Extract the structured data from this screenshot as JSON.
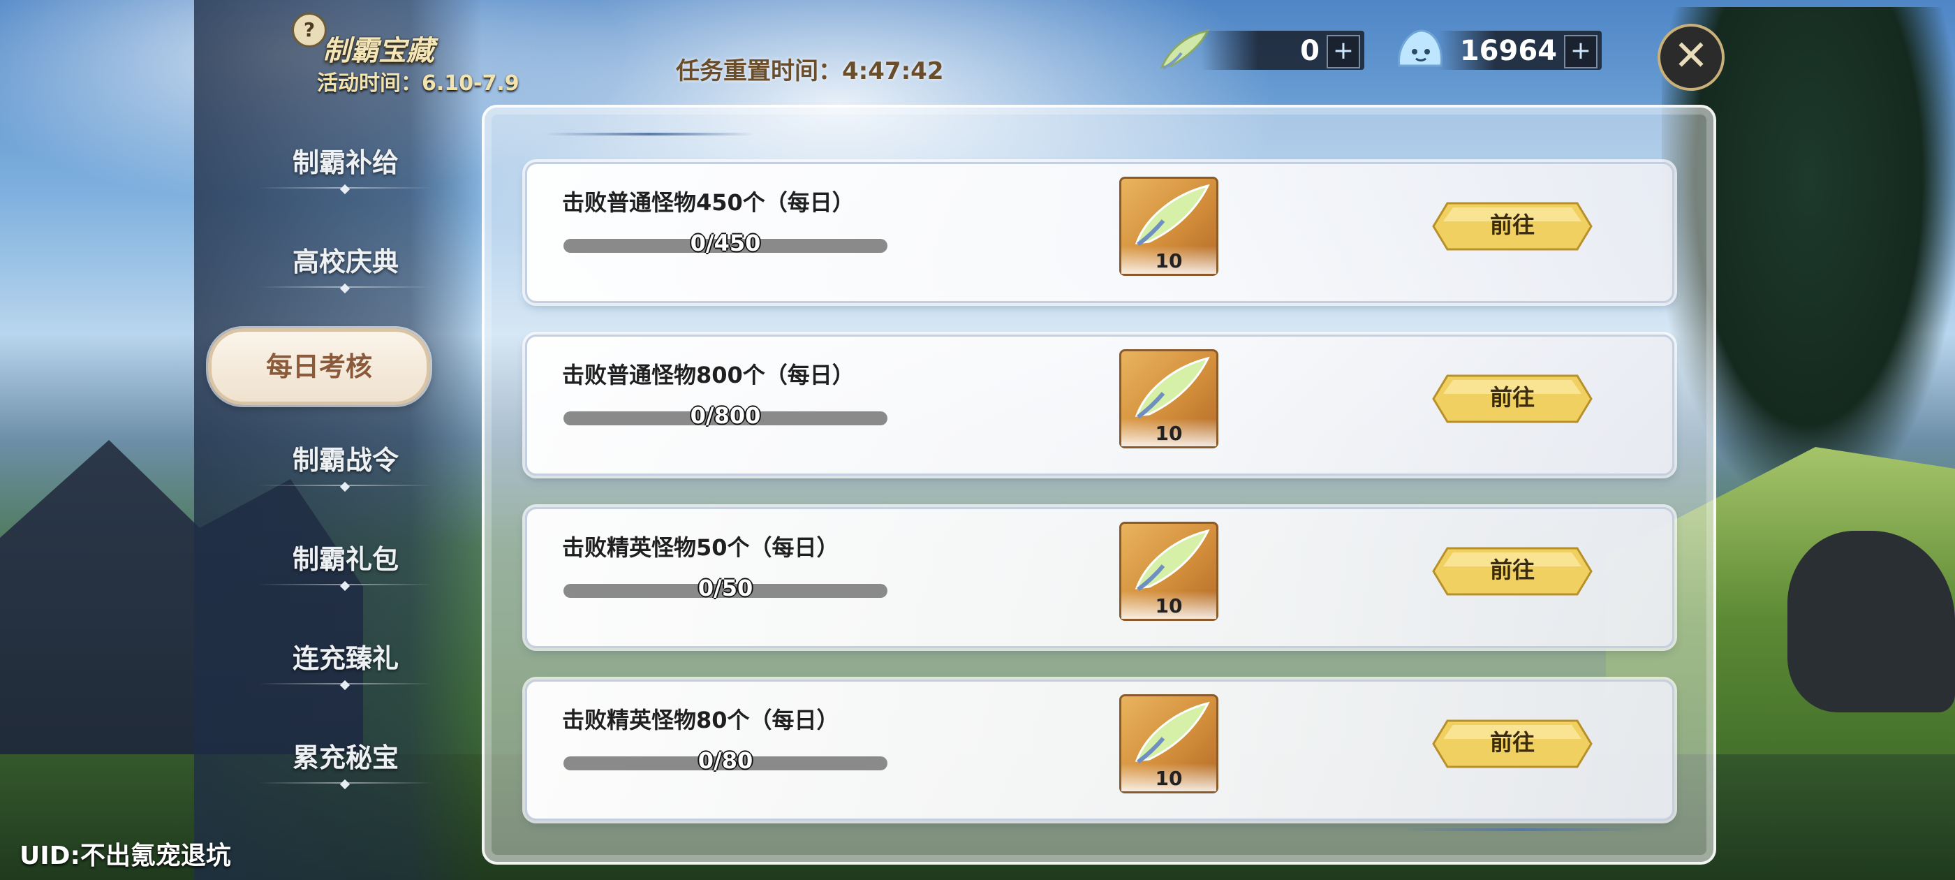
{
  "event": {
    "title": "制霸宝藏",
    "time_label": "活动时间：6.10-7.9"
  },
  "topbar": {
    "reset_label": "任务重置时间：4:47:42",
    "currencies": [
      {
        "icon": "wing-feather-icon",
        "amount": "0",
        "plus": "+"
      },
      {
        "icon": "slime-gem-icon",
        "amount": "16964",
        "plus": "+"
      }
    ],
    "close": "✕"
  },
  "sidebar": {
    "items": [
      {
        "label": "制霸补给"
      },
      {
        "label": "高校庆典"
      },
      {
        "label": "每日考核",
        "active": true
      },
      {
        "label": "制霸战令"
      },
      {
        "label": "制霸礼包"
      },
      {
        "label": "连充臻礼"
      },
      {
        "label": "累充秘宝"
      }
    ]
  },
  "uid": "UID:不出氪宠退坑",
  "tasks": [
    {
      "name": "击败普通怪物450个（每日）",
      "progress_text": "0/450",
      "progress": 0,
      "reward_count": "10",
      "button": "前往"
    },
    {
      "name": "击败普通怪物800个（每日）",
      "progress_text": "0/800",
      "progress": 0,
      "reward_count": "10",
      "button": "前往"
    },
    {
      "name": "击败精英怪物50个（每日）",
      "progress_text": "0/50",
      "progress": 0,
      "reward_count": "10",
      "button": "前往"
    },
    {
      "name": "击败精英怪物80个（每日）",
      "progress_text": "0/80",
      "progress": 0,
      "reward_count": "10",
      "button": "前往"
    }
  ],
  "colors": {
    "accent_gold": "#e8c55a",
    "active_tab_text": "#8a5a3a",
    "title_gold": "#f5e6b8"
  }
}
